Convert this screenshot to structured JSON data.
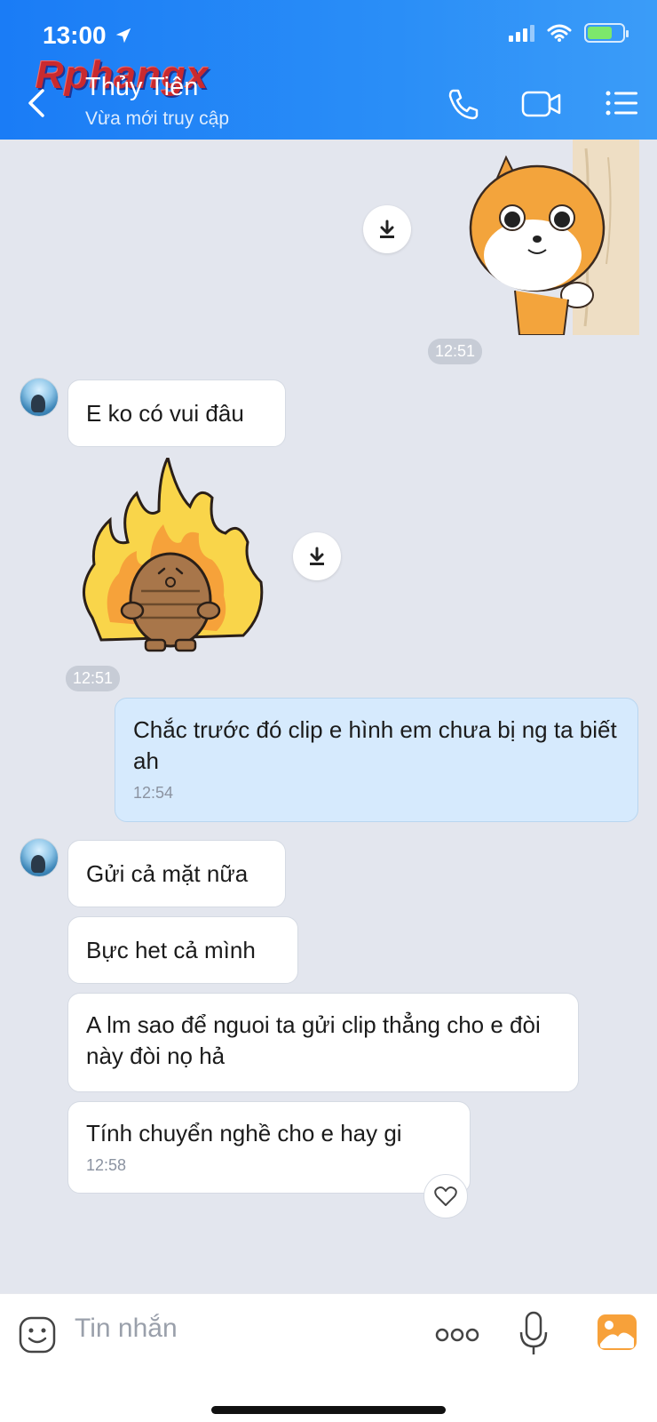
{
  "status_bar": {
    "time": "13:00"
  },
  "header": {
    "watermark": "Rphangx",
    "contact_name": "Thủy Tiên",
    "contact_status": "Vừa mới truy cập"
  },
  "messages": {
    "time_1": "12:51",
    "text_1": "E ko có vui đâu",
    "time_2": "12:51",
    "me_text": "Chắc trước đó clip e hình em chưa bị ng ta biết ah",
    "me_time": "12:54",
    "text_2": "Gửi cả mặt nữa",
    "text_3": "Bực het cả mình",
    "text_4": "A lm sao để nguoi ta gửi clip thẳng cho e đòi này đòi nọ hả",
    "text_5": "Tính chuyển nghề cho e hay gi",
    "text_5_time": "12:58"
  },
  "input": {
    "placeholder": "Tin nhắn"
  },
  "colors": {
    "header": "#1a7cf6",
    "my_bubble": "#d6eafd",
    "chat_bg": "#e3e6ee",
    "accent_orange": "#f7a13a"
  },
  "icons": [
    "location-arrow-icon",
    "signal-icon",
    "wifi-icon",
    "battery-icon",
    "back-icon",
    "phone-icon",
    "video-call-icon",
    "menu-icon",
    "download-icon",
    "heart-icon",
    "emoji-icon",
    "more-icon",
    "mic-icon",
    "image-icon"
  ]
}
